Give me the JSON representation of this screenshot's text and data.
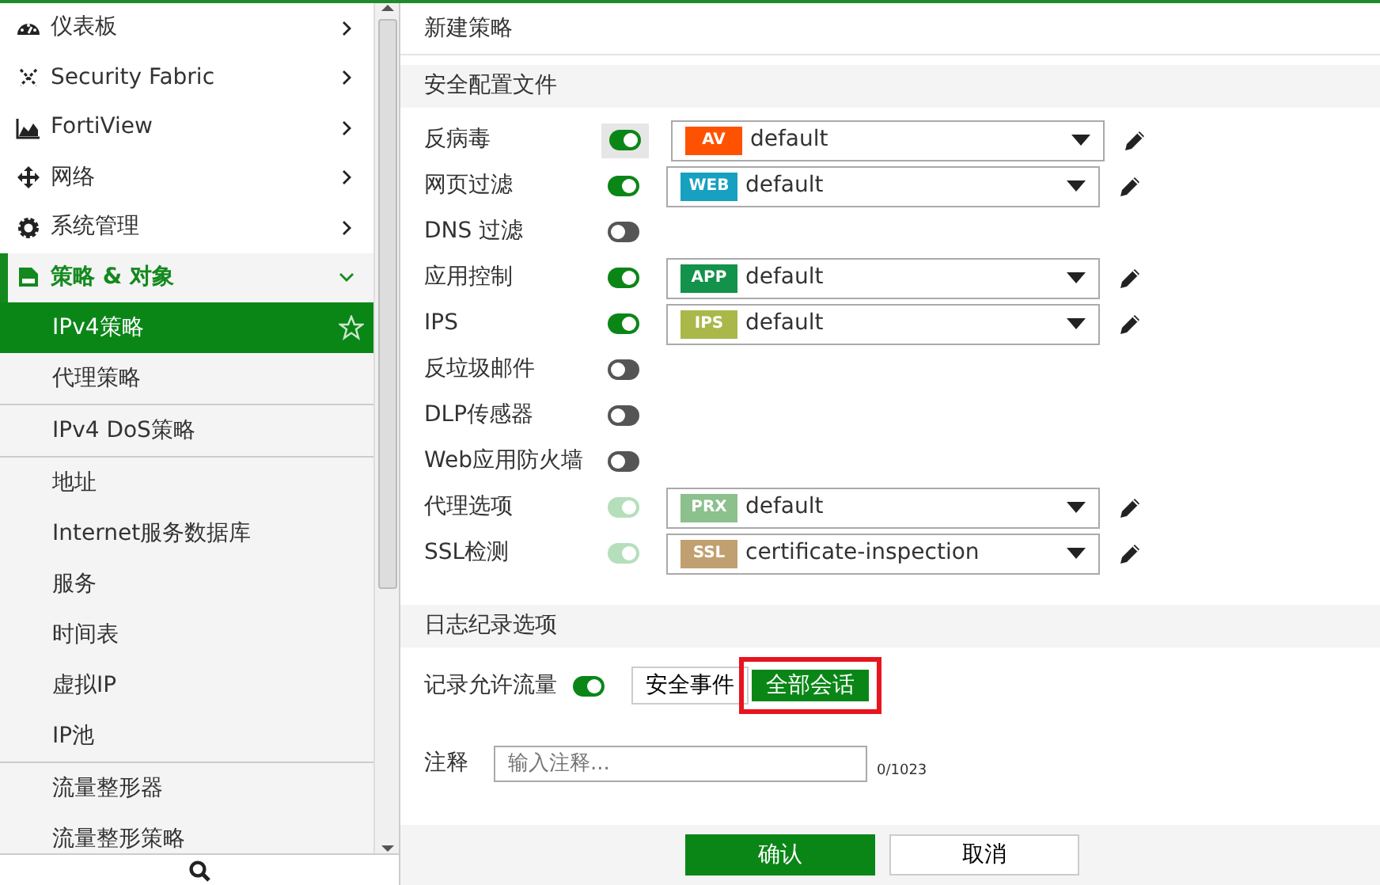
{
  "sidebar": {
    "menu": [
      {
        "label": "仪表板",
        "expanded": false
      },
      {
        "label": "Security Fabric",
        "expanded": false
      },
      {
        "label": "FortiView",
        "expanded": false
      },
      {
        "label": "网络",
        "expanded": false
      },
      {
        "label": "系统管理",
        "expanded": false
      },
      {
        "label": "策略 & 对象",
        "expanded": true
      }
    ],
    "groups": [
      [
        {
          "label": "IPv4策略",
          "selected": true
        },
        {
          "label": "代理策略",
          "selected": false
        }
      ],
      [
        {
          "label": "IPv4 DoS策略",
          "selected": false
        }
      ],
      [
        {
          "label": "地址",
          "selected": false
        },
        {
          "label": "Internet服务数据库",
          "selected": false
        },
        {
          "label": "服务",
          "selected": false
        },
        {
          "label": "时间表",
          "selected": false
        },
        {
          "label": "虚拟IP",
          "selected": false
        },
        {
          "label": "IP池",
          "selected": false
        }
      ],
      [
        {
          "label": "流量整形器",
          "selected": false
        },
        {
          "label": "流量整形策略",
          "selected": false
        }
      ]
    ]
  },
  "page_title": "新建策略",
  "profiles": {
    "title": "安全配置文件",
    "rows": [
      {
        "label": "反病毒",
        "on": true,
        "disabled": false,
        "focused": true,
        "tag": "AV",
        "color": "#ff5200",
        "value": "default"
      },
      {
        "label": "网页过滤",
        "on": true,
        "disabled": false,
        "focused": false,
        "tag": "WEB",
        "color": "#18a0c0",
        "value": "default"
      },
      {
        "label": "DNS 过滤",
        "on": false,
        "disabled": false,
        "focused": false
      },
      {
        "label": "应用控制",
        "on": true,
        "disabled": false,
        "focused": false,
        "tag": "APP",
        "color": "#12924a",
        "value": "default"
      },
      {
        "label": "IPS",
        "on": true,
        "disabled": false,
        "focused": false,
        "tag": "IPS",
        "color": "#aab84a",
        "value": "default"
      },
      {
        "label": "反垃圾邮件",
        "on": false,
        "disabled": false,
        "focused": false
      },
      {
        "label": "DLP传感器",
        "on": false,
        "disabled": false,
        "focused": false
      },
      {
        "label": "Web应用防火墙",
        "on": false,
        "disabled": false,
        "focused": false
      },
      {
        "label": "代理选项",
        "on": true,
        "disabled": true,
        "focused": false,
        "tag": "PRX",
        "color": "#8cc08c",
        "value": "default"
      },
      {
        "label": "SSL检测",
        "on": true,
        "disabled": true,
        "focused": false,
        "tag": "SSL",
        "color": "#c0a070",
        "value": "certificate-inspection"
      }
    ]
  },
  "logging": {
    "title": "日志纪录选项",
    "label": "记录允许流量",
    "on": true,
    "options": [
      {
        "label": "安全事件",
        "selected": false,
        "highlighted": false
      },
      {
        "label": "全部会话",
        "selected": true,
        "highlighted": true
      }
    ]
  },
  "comment": {
    "label": "注释",
    "placeholder": "输入注释...",
    "counter": "0/1023"
  },
  "buttons": [
    {
      "label": "确认",
      "kind": "primary"
    },
    {
      "label": "取消",
      "kind": "secondary"
    }
  ]
}
